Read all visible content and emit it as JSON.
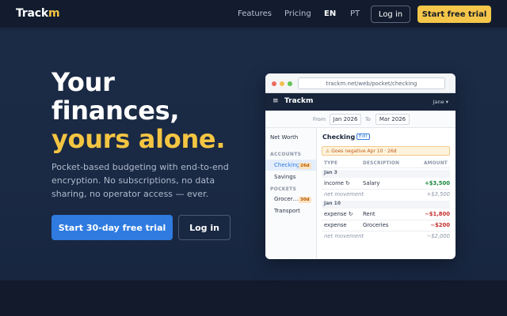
{
  "nav": {
    "logo_prefix": "Track",
    "logo_suffix": "m",
    "features": "Features",
    "pricing": "Pricing",
    "lang_en": "EN",
    "lang_pt": "PT",
    "login": "Log in",
    "trial": "Start free trial"
  },
  "hero": {
    "headline_line1": "Your",
    "headline_line2": "finances,",
    "headline_line3": "yours alone.",
    "subtitle": "Pocket-based budgeting with end-to-end encryption. No subscriptions, no data sharing, no operator access — ever.",
    "cta_primary": "Start 30-day free trial",
    "cta_secondary": "Log in"
  },
  "mock": {
    "url": "trackm.net/web/pocket/checking",
    "app_title": "Trackm",
    "user": "Jane ▾",
    "menu_icon": "hamburger-icon",
    "from_label": "From",
    "from_value": "Jan 2026",
    "to_label": "To",
    "to_value": "Mar 2026",
    "sidebar": {
      "net_worth": "Net Worth",
      "accounts_head": "ACCOUNTS",
      "checking": "Checking",
      "checking_badge": "26d",
      "savings": "Savings",
      "pockets_head": "POCKETS",
      "groceries": "Grocer…",
      "groceries_badge": "30d",
      "transport": "Transport"
    },
    "account_title": "Checking",
    "edit_label": "Edit",
    "warning": "⚠ Goes negative Apr 10 · 26d",
    "columns": {
      "type": "TYPE",
      "description": "DESCRIPTION",
      "amount": "AMOUNT"
    },
    "groups": [
      {
        "date": "Jan 3",
        "rows": [
          {
            "type": "income ↻",
            "description": "Salary",
            "amount": "+$3,500",
            "kind": "pos"
          }
        ],
        "net_label": "net movement",
        "net_value": "+$3,500"
      },
      {
        "date": "Jan 10",
        "rows": [
          {
            "type": "expense ↻",
            "description": "Rent",
            "amount": "−$1,800",
            "kind": "neg"
          },
          {
            "type": "expense",
            "description": "Groceries",
            "amount": "−$200",
            "kind": "neg"
          }
        ],
        "net_label": "net movement",
        "net_value": "−$2,000"
      }
    ]
  },
  "colors": {
    "accent_yellow": "#f4c542",
    "primary_blue": "#2f7be0",
    "background": "#172238",
    "positive": "#16873a",
    "negative": "#c52e2e"
  }
}
